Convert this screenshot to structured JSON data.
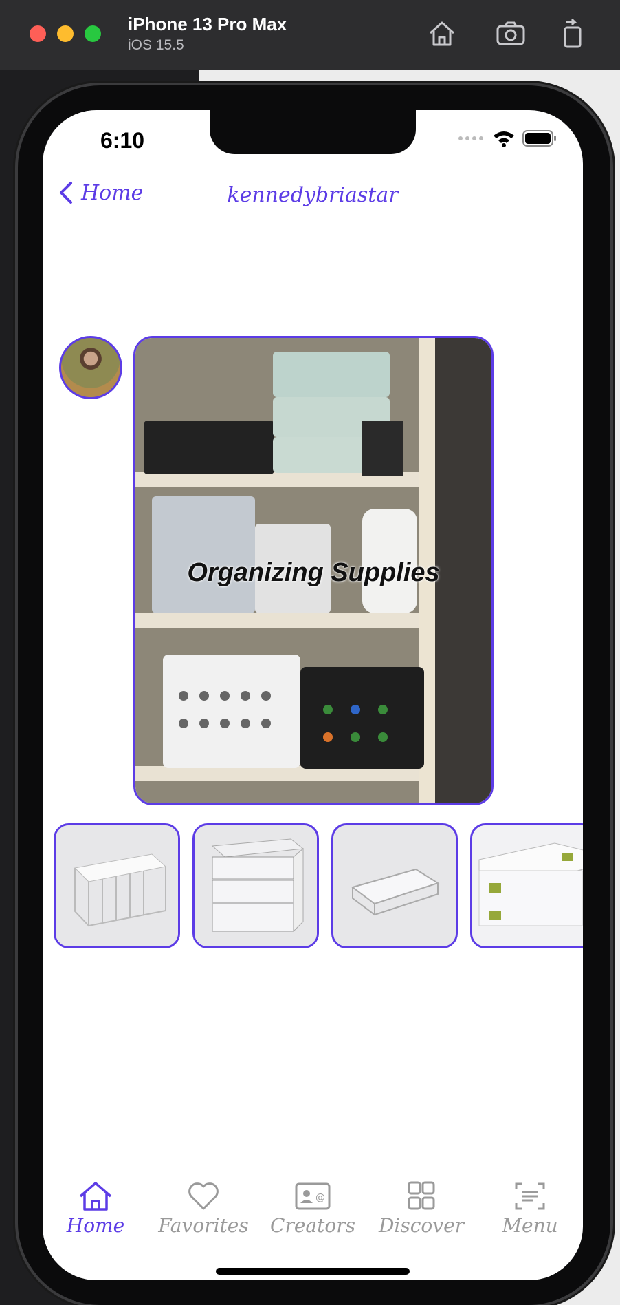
{
  "simulator": {
    "device_name": "iPhone 13 Pro Max",
    "os_version": "iOS 15.5",
    "buttons": [
      "home-icon",
      "screenshot-icon",
      "rotate-icon"
    ]
  },
  "status_bar": {
    "time": "6:10"
  },
  "nav": {
    "back_label": "Home",
    "title": "kennedybriastar"
  },
  "video": {
    "caption": "Organizing Supplies"
  },
  "products": [
    {
      "name": "white-wire-basket"
    },
    {
      "name": "clear-drawer-unit"
    },
    {
      "name": "clear-tray"
    },
    {
      "name": "clear-latch-box"
    }
  ],
  "tabs": [
    {
      "label": "Home",
      "icon": "home-icon",
      "active": true
    },
    {
      "label": "Favorites",
      "icon": "heart-icon",
      "active": false
    },
    {
      "label": "Creators",
      "icon": "contact-card-icon",
      "active": false
    },
    {
      "label": "Discover",
      "icon": "grid-icon",
      "active": false
    },
    {
      "label": "Menu",
      "icon": "menu-scan-icon",
      "active": false
    }
  ],
  "colors": {
    "accent": "#5c3ce6",
    "inactive": "#9a9a9a"
  }
}
